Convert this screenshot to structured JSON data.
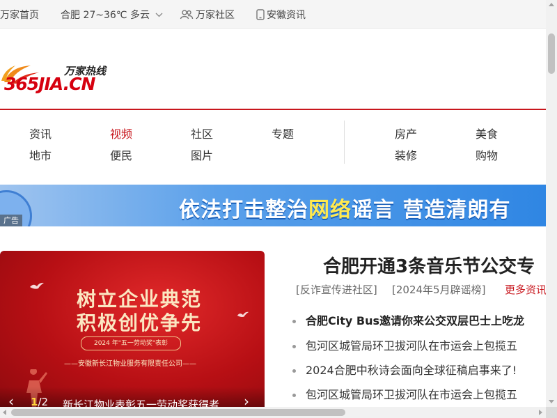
{
  "topbar": {
    "home_link": "万家首页",
    "weather": "合肥 27~36℃ 多云",
    "community_link": "万家社区",
    "app_link": "安徽资讯"
  },
  "logo": {
    "brand": "365JIA.CN",
    "slogan": "万家热线"
  },
  "nav": {
    "col1": [
      "资讯",
      "地市"
    ],
    "col2": [
      "视频",
      "便民"
    ],
    "col3": [
      "社区",
      "图片"
    ],
    "col4": [
      "专题"
    ],
    "col5": [
      "房产",
      "装修"
    ],
    "col6": [
      "美食",
      "购物"
    ],
    "active": "视频"
  },
  "banner": {
    "text_before": "依法打击整治",
    "text_highlight": "网络",
    "text_after": "谣言  营造清朗有",
    "ad_label": "广告"
  },
  "slider": {
    "poster_line1": "树立企业典范",
    "poster_line2": "积极创优争先",
    "poster_award": "2024 年\"五一劳动奖\"表彰",
    "poster_company": "——安徽新长江物业服务有限责任公司——",
    "counter_current": "1",
    "counter_sep": "/2",
    "caption": "新长江物业表彰五一劳动奖获得者"
  },
  "news": {
    "headline": "合肥开通3条音乐节公交专",
    "meta": [
      "[反诈宣传进社区]",
      "[2024年5月辟谣榜]"
    ],
    "more": "更多资讯",
    "items": [
      "合肥City Bus邀请你来公交双层巴士上吃龙",
      "包河区城管局环卫拔河队在市运会上包揽五",
      "2024合肥中秋诗会面向全球征稿启事来了!",
      "包河区城管局环卫拔河队在市运会上包揽五"
    ]
  },
  "colors": {
    "brand_red": "#c8161d",
    "banner_blue": "#2f86e3",
    "slider_red": "#b70f14"
  }
}
